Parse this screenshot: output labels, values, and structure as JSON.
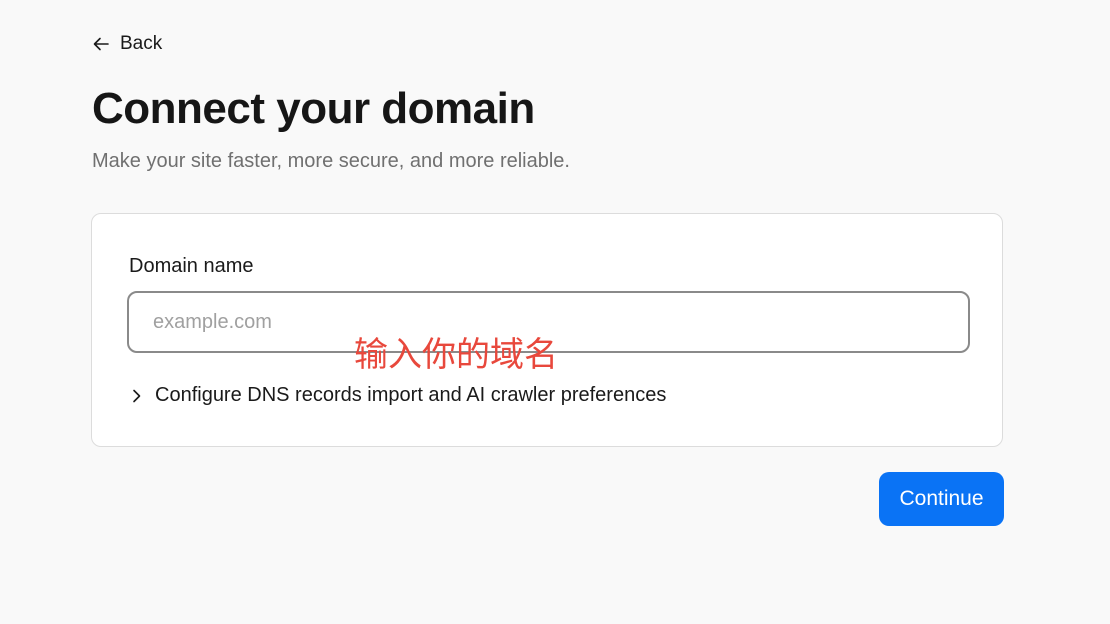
{
  "nav": {
    "back_label": "Back",
    "back_icon": "arrow-left-icon"
  },
  "header": {
    "title": "Connect your domain",
    "subtitle": "Make your site faster, more secure, and more reliable."
  },
  "form": {
    "domain_label": "Domain name",
    "domain_placeholder": "example.com",
    "domain_value": "",
    "annotation_text": "输入你的域名",
    "annotation_color": "#e8483c",
    "advanced_label": "Configure DNS records import and AI crawler preferences",
    "advanced_icon": "chevron-right-icon"
  },
  "actions": {
    "continue_label": "Continue",
    "continue_color": "#0a73f5"
  }
}
